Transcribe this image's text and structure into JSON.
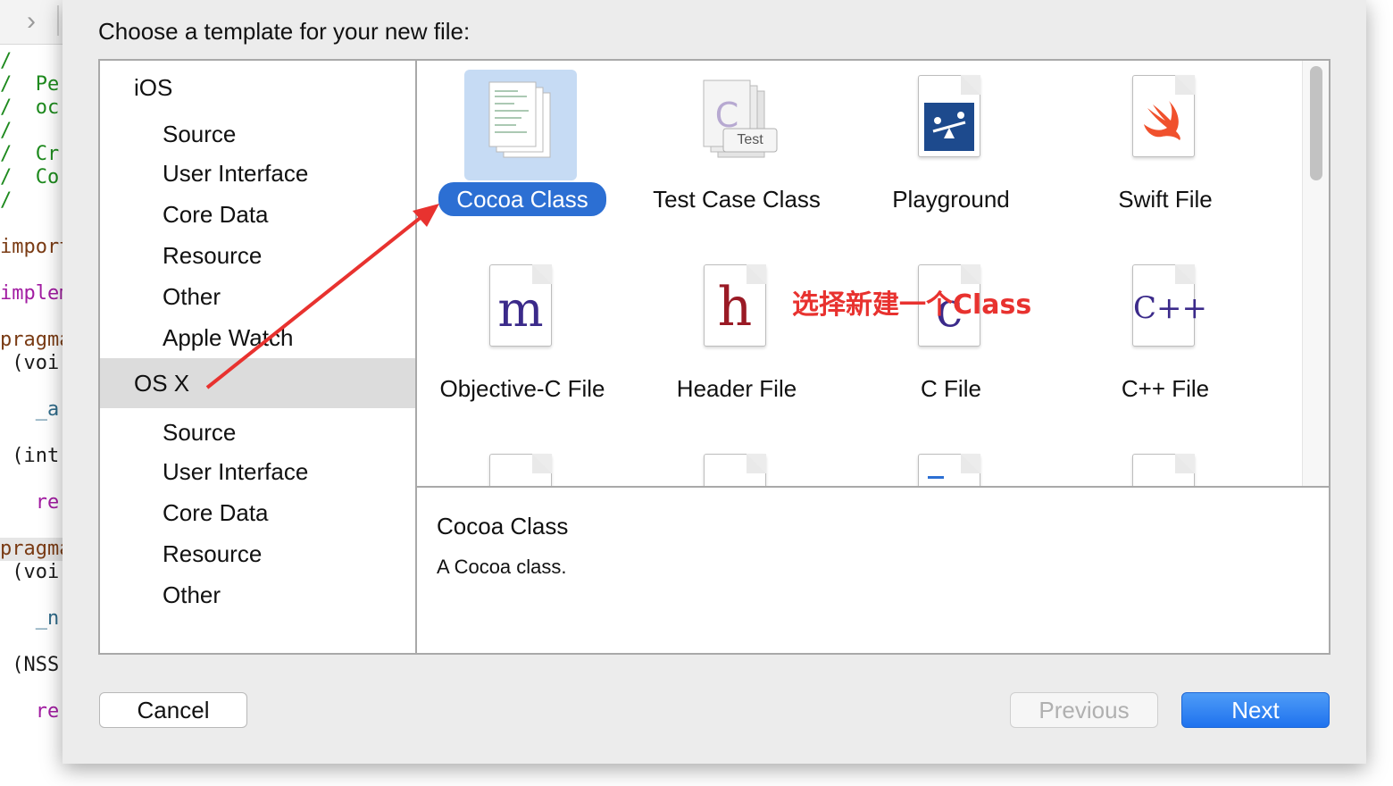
{
  "editor": {
    "lines": [
      {
        "text": "/",
        "cls": "c-green"
      },
      {
        "text": "/  Pe",
        "cls": "c-green"
      },
      {
        "text": "/  oc",
        "cls": "c-green"
      },
      {
        "text": "/",
        "cls": "c-green"
      },
      {
        "text": "/  Cr",
        "cls": "c-green"
      },
      {
        "text": "/  Co",
        "cls": "c-green"
      },
      {
        "text": "/",
        "cls": "c-green"
      },
      {
        "text": "import",
        "cls": "c-brown"
      },
      {
        "text": "implem",
        "cls": "c-purple"
      },
      {
        "text": "pragma",
        "cls": "c-brown"
      },
      {
        "text": " (voi",
        "cls": "c-black"
      },
      {
        "text": "   _a",
        "cls": "c-teal"
      },
      {
        "text": " (int",
        "cls": "c-black"
      },
      {
        "text": "   re",
        "cls": "c-purple"
      },
      {
        "text": "pragma",
        "cls": "c-brown"
      },
      {
        "text": " (voi",
        "cls": "c-black"
      },
      {
        "text": "   _n",
        "cls": "c-teal"
      },
      {
        "text": " (NSS",
        "cls": "c-black"
      },
      {
        "text": "   re",
        "cls": "c-purple"
      }
    ]
  },
  "dialog": {
    "title": "Choose a template for your new file:",
    "sidebar": {
      "groups": [
        {
          "header": "iOS",
          "items": [
            "Source",
            "User Interface",
            "Core Data",
            "Resource",
            "Other",
            "Apple Watch"
          ]
        },
        {
          "header": "OS X",
          "items": [
            "Source",
            "User Interface",
            "Core Data",
            "Resource",
            "Other"
          ],
          "selected": true
        }
      ]
    },
    "templates": [
      {
        "label": "Cocoa Class",
        "icon": "cocoa-class-icon",
        "selected": true
      },
      {
        "label": "Test Case Class",
        "icon": "test-case-class-icon"
      },
      {
        "label": "Playground",
        "icon": "playground-icon"
      },
      {
        "label": "Swift File",
        "icon": "swift-file-icon"
      },
      {
        "label": "Objective-C File",
        "icon": "objective-c-file-icon",
        "glyph": "m"
      },
      {
        "label": "Header File",
        "icon": "header-file-icon",
        "glyph": "h"
      },
      {
        "label": "C File",
        "icon": "c-file-icon",
        "glyph": "c"
      },
      {
        "label": "C++ File",
        "icon": "cpp-file-icon",
        "glyph": "C++"
      }
    ],
    "test_badge": "Test",
    "annotation": "选择新建一个Class",
    "description": {
      "title": "Cocoa Class",
      "text": "A Cocoa class."
    },
    "buttons": {
      "cancel": "Cancel",
      "previous": "Previous",
      "next": "Next"
    },
    "colors": {
      "accent": "#2c6fd3",
      "annotation": "#e8322f",
      "selection_bg": "#c6dbf4"
    }
  }
}
